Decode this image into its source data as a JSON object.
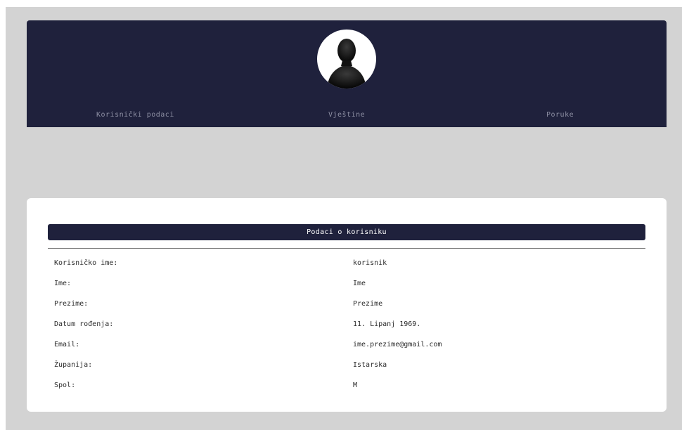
{
  "nav": {
    "tabs": [
      {
        "label": "Korisnički podaci"
      },
      {
        "label": "Vještine"
      },
      {
        "label": "Poruke"
      }
    ]
  },
  "profile": {
    "avatar_icon": "user-silhouette-icon",
    "section_title": "Podaci o korisniku",
    "fields": [
      {
        "label": "Korisničko ime:",
        "value": "korisnik"
      },
      {
        "label": "Ime:",
        "value": "Ime"
      },
      {
        "label": "Prezime:",
        "value": "Prezime"
      },
      {
        "label": "Datum rođenja:",
        "value": "11. Lipanj 1969."
      },
      {
        "label": "Email:",
        "value": "ime.prezime@gmail.com"
      },
      {
        "label": "Županija:",
        "value": "Istarska"
      },
      {
        "label": "Spol:",
        "value": "M"
      }
    ]
  },
  "colors": {
    "header_bg": "#1f213c",
    "page_bg": "#d3d3d3",
    "card_bg": "#ffffff"
  }
}
